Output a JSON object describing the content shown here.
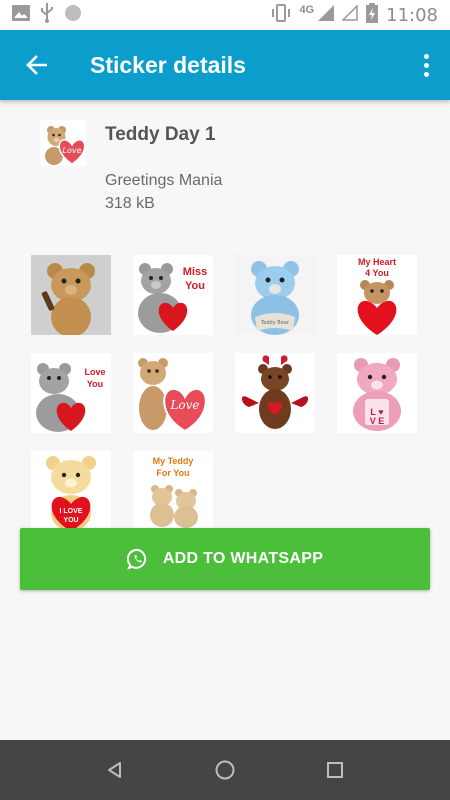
{
  "status_bar": {
    "network": "4G",
    "time": "11:08",
    "icons": [
      "image-icon",
      "usb-icon",
      "circle-icon",
      "vibrate-icon",
      "signal-icon",
      "signal-empty-icon",
      "battery-icon"
    ]
  },
  "app_bar": {
    "title": "Sticker details",
    "back_icon": "arrow-back-icon",
    "menu_icon": "more-vert-icon",
    "color": "#0b9dcc"
  },
  "pack": {
    "title": "Teddy Day 1",
    "publisher": "Greetings Mania",
    "size": "318 kB"
  },
  "stickers": [
    {
      "caption": ""
    },
    {
      "caption": "Miss You"
    },
    {
      "caption": ""
    },
    {
      "caption": "My Heart 4 You"
    },
    {
      "caption": "Love You"
    },
    {
      "caption": "Love"
    },
    {
      "caption": ""
    },
    {
      "caption": ""
    },
    {
      "caption": "I LOVE YOU"
    },
    {
      "caption": "My Teddy For You"
    }
  ],
  "add_button": {
    "label": "ADD TO WHATSAPP",
    "icon": "whatsapp-icon",
    "color": "#4cbf3a"
  },
  "nav_bar": {
    "buttons": [
      "back-triangle-icon",
      "home-circle-icon",
      "recents-square-icon"
    ]
  }
}
